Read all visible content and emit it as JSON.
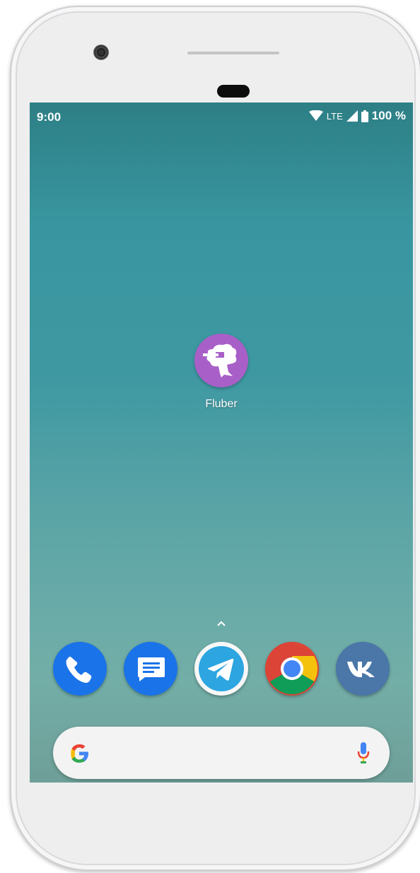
{
  "status_bar": {
    "time": "9:00",
    "network": "LTE",
    "battery": "100 %",
    "icons": [
      "wifi-icon",
      "signal-icon",
      "battery-icon"
    ]
  },
  "home": {
    "apps": [
      {
        "label": "Fluber",
        "icon": "fluber-tree-icon",
        "color": "#a95fc8"
      }
    ]
  },
  "app_drawer_hint": "chevron-up-icon",
  "dock": {
    "apps": [
      {
        "icon": "phone-icon",
        "color": "#1a73e8"
      },
      {
        "icon": "messages-icon",
        "color": "#1a73e8"
      },
      {
        "icon": "telegram-icon",
        "color": "#2ca5e0"
      },
      {
        "icon": "chrome-icon",
        "color": "#db4437"
      },
      {
        "icon": "vk-icon",
        "color": "#4a76a8"
      }
    ]
  },
  "search_bar": {
    "left_icon": "google-g-icon",
    "right_icon": "microphone-icon"
  }
}
